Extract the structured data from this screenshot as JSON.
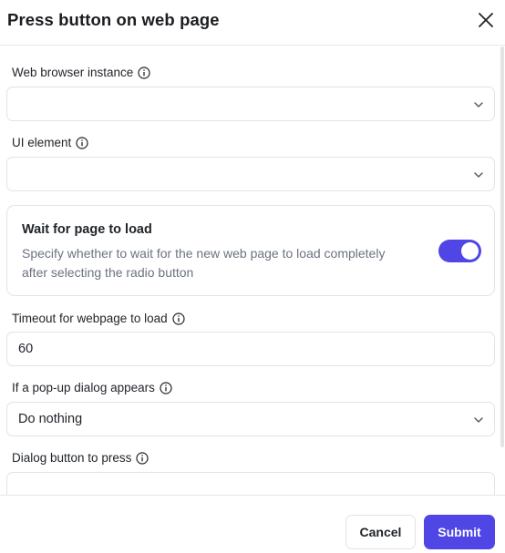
{
  "dialog": {
    "title": "Press button on web page"
  },
  "fields": {
    "browser_instance": {
      "label": "Web browser instance",
      "value": ""
    },
    "ui_element": {
      "label": "UI element",
      "value": ""
    },
    "wait_card": {
      "title": "Wait for page to load",
      "description": "Specify whether to wait for the new web page to load completely after selecting the radio button",
      "toggle_on": true
    },
    "timeout": {
      "label": "Timeout for webpage to load",
      "value": "60"
    },
    "popup": {
      "label": "If a pop-up dialog appears",
      "value": "Do nothing"
    },
    "dialog_button": {
      "label": "Dialog button to press",
      "value": ""
    }
  },
  "footer": {
    "cancel_label": "Cancel",
    "submit_label": "Submit"
  },
  "colors": {
    "accent": "#4f46e5",
    "border": "#e1e3e7",
    "muted_text": "#6b7280"
  },
  "icons": {
    "close": "close-icon",
    "info": "info-icon",
    "chevron": "chevron-down-icon"
  }
}
